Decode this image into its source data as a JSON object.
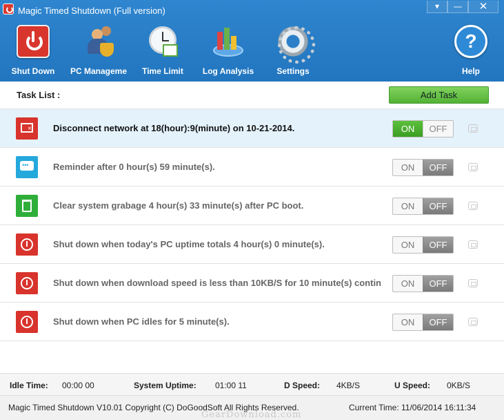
{
  "window": {
    "title": "Magic Timed Shutdown (Full version)",
    "controls": {
      "menu": "▾",
      "minimize": "—",
      "close": "✕"
    }
  },
  "toolbar": {
    "shutdown": "Shut Down",
    "pc_management": "PC Manageme",
    "time_limit": "Time Limit",
    "log_analysis": "Log Analysis",
    "settings": "Settings",
    "help": "Help",
    "help_glyph": "?"
  },
  "tasklist": {
    "title": "Task List :",
    "add_task": "Add Task",
    "on_label": "ON",
    "off_label": "OFF",
    "tasks": [
      {
        "icon": "network-icon",
        "text": "Disconnect network at 18(hour):9(minute) on  10-21-2014.",
        "enabled": true
      },
      {
        "icon": "reminder-icon",
        "text": "Reminder after 0 hour(s) 59 minute(s).",
        "enabled": false
      },
      {
        "icon": "trash-icon",
        "text": "Clear system grabage 4 hour(s) 33 minute(s) after PC boot.",
        "enabled": false
      },
      {
        "icon": "power-icon",
        "text": "Shut down when today's PC uptime totals 4 hour(s) 0 minute(s).",
        "enabled": false
      },
      {
        "icon": "power-icon",
        "text": "Shut down when download speed is less than 10KB/S for 10 minute(s) contin",
        "enabled": false
      },
      {
        "icon": "power-icon",
        "text": "Shut down when PC idles for 5 minute(s).",
        "enabled": false
      }
    ]
  },
  "status": {
    "idle_label": "Idle Time:",
    "idle_value": "00:00 00",
    "uptime_label": "System Uptime:",
    "uptime_value": "01:00 11",
    "dspeed_label": "D Speed:",
    "dspeed_value": "4KB/S",
    "uspeed_label": "U Speed:",
    "uspeed_value": "0KB/S"
  },
  "footer": {
    "copyright": "Magic Timed Shutdown V10.01  Copyright (C)  DoGoodSoft All Rights Reserved.",
    "current_time": "Current Time: 11/06/2014 16:11:34",
    "watermark": "GearDownload.com"
  }
}
